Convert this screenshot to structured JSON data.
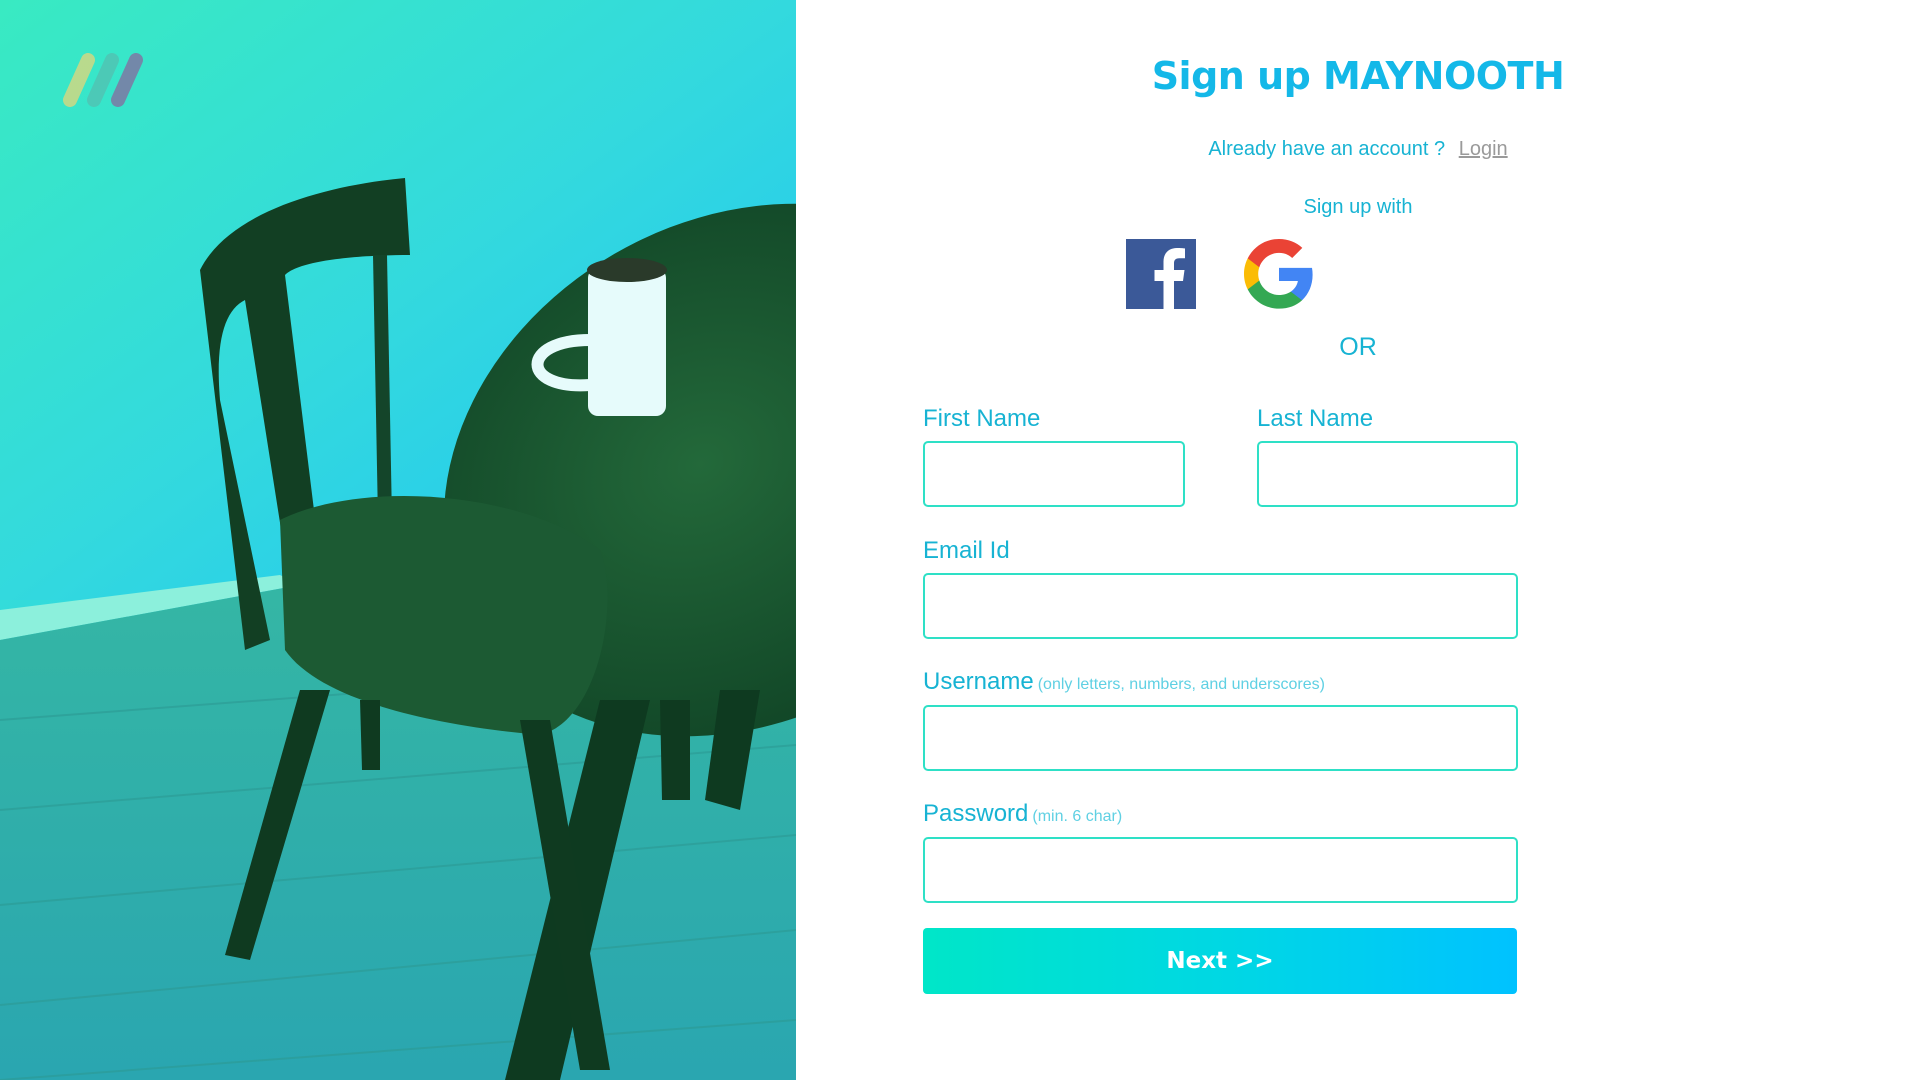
{
  "brand": {
    "logo_icon": "brand-logo-icon",
    "logo_colors": [
      "#c7d987",
      "#4fc6b5",
      "#7a7fa6"
    ]
  },
  "hero": {
    "image": "dining-chair-table-coffee-mug-photo"
  },
  "form": {
    "title": "Sign up MAYNOOTH",
    "account_prompt": "Already have an account ?",
    "login_label": "Login",
    "signup_with": "Sign up with",
    "social_buttons": [
      {
        "name": "facebook",
        "icon": "facebook-icon"
      },
      {
        "name": "google",
        "icon": "google-icon"
      }
    ],
    "or_label": "OR",
    "fields": {
      "first_name": {
        "label": "First Name",
        "value": "",
        "placeholder": ""
      },
      "last_name": {
        "label": "Last Name",
        "value": "",
        "placeholder": ""
      },
      "email": {
        "label": "Email Id",
        "value": "",
        "placeholder": ""
      },
      "username": {
        "label": "Username",
        "hint": "(only letters, numbers, and underscores)",
        "value": "",
        "placeholder": ""
      },
      "password": {
        "label": "Password",
        "hint": "(min. 6 char)",
        "value": "",
        "placeholder": ""
      }
    },
    "next_label": "Next >>"
  },
  "colors": {
    "accent": "#17b3d3",
    "title": "#14b8e8",
    "input_border": "#2ee0c6",
    "button_gradient_start": "#00e6c8",
    "button_gradient_end": "#00c2ff",
    "link_muted": "#9a9a9a"
  }
}
